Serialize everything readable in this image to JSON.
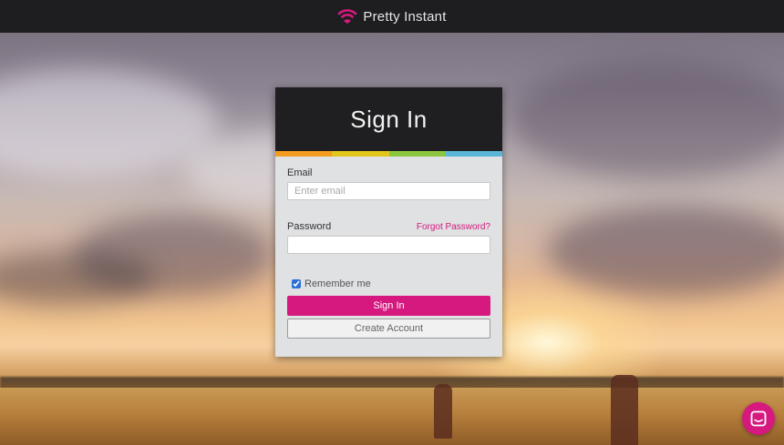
{
  "header": {
    "brand_name": "Pretty Instant",
    "logo_icon": "wifi-icon",
    "brand_color": "#d6197f"
  },
  "login": {
    "title": "Sign In",
    "stripe_colors": [
      "#f39c1f",
      "#e3c61a",
      "#8cc63f",
      "#5bb5d9"
    ],
    "email_label": "Email",
    "email_placeholder": "Enter email",
    "email_value": "",
    "password_label": "Password",
    "password_value": "",
    "forgot_link": "Forgot Password?",
    "remember_label": "Remember me",
    "remember_checked": true,
    "sign_in_button": "Sign In",
    "create_account_button": "Create Account"
  },
  "chat_widget": {
    "icon": "chat-icon"
  }
}
